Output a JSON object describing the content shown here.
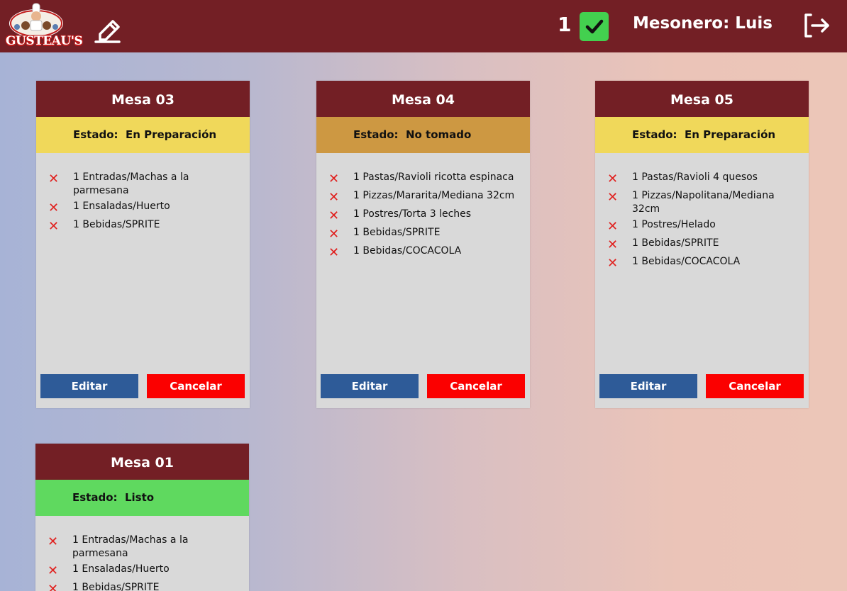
{
  "header": {
    "logo_text": "GUSTEAU'S",
    "ready_count": "1",
    "waiter_label": "Mesonero: Luis"
  },
  "colors": {
    "header_bg": "#731f25",
    "status_preparing": "#f0d85a",
    "status_not_taken": "#cd9842",
    "status_ready": "#5fd95f",
    "edit_button": "#2e5b98",
    "cancel_button": "#fb0000",
    "remove_x": "#e0201e"
  },
  "cards": [
    {
      "title": "Mesa 03",
      "status": "Estado:  En Preparación",
      "items": [
        "1 Entradas/Machas a la parmesana",
        "1 Ensaladas/Huerto",
        "1 Bebidas/SPRITE"
      ],
      "edit_label": "Editar",
      "cancel_label": "Cancelar"
    },
    {
      "title": "Mesa 04",
      "status": "Estado:  No tomado",
      "items": [
        "1 Pastas/Ravioli ricotta espinaca",
        "1 Pizzas/Mararita/Mediana 32cm",
        "1 Postres/Torta 3 leches",
        "1 Bebidas/SPRITE",
        "1 Bebidas/COCACOLA"
      ],
      "edit_label": "Editar",
      "cancel_label": "Cancelar"
    },
    {
      "title": "Mesa 05",
      "status": "Estado:  En Preparación",
      "items": [
        "1 Pastas/Ravioli 4 quesos",
        "1 Pizzas/Napolitana/Mediana 32cm",
        "1 Postres/Helado",
        "1 Bebidas/SPRITE",
        "1 Bebidas/COCACOLA"
      ],
      "edit_label": "Editar",
      "cancel_label": "Cancelar"
    },
    {
      "title": "Mesa 01",
      "status": "Estado:  Listo",
      "items": [
        "1 Entradas/Machas a la parmesana",
        "1 Ensaladas/Huerto",
        "1 Bebidas/SPRITE"
      ]
    }
  ]
}
